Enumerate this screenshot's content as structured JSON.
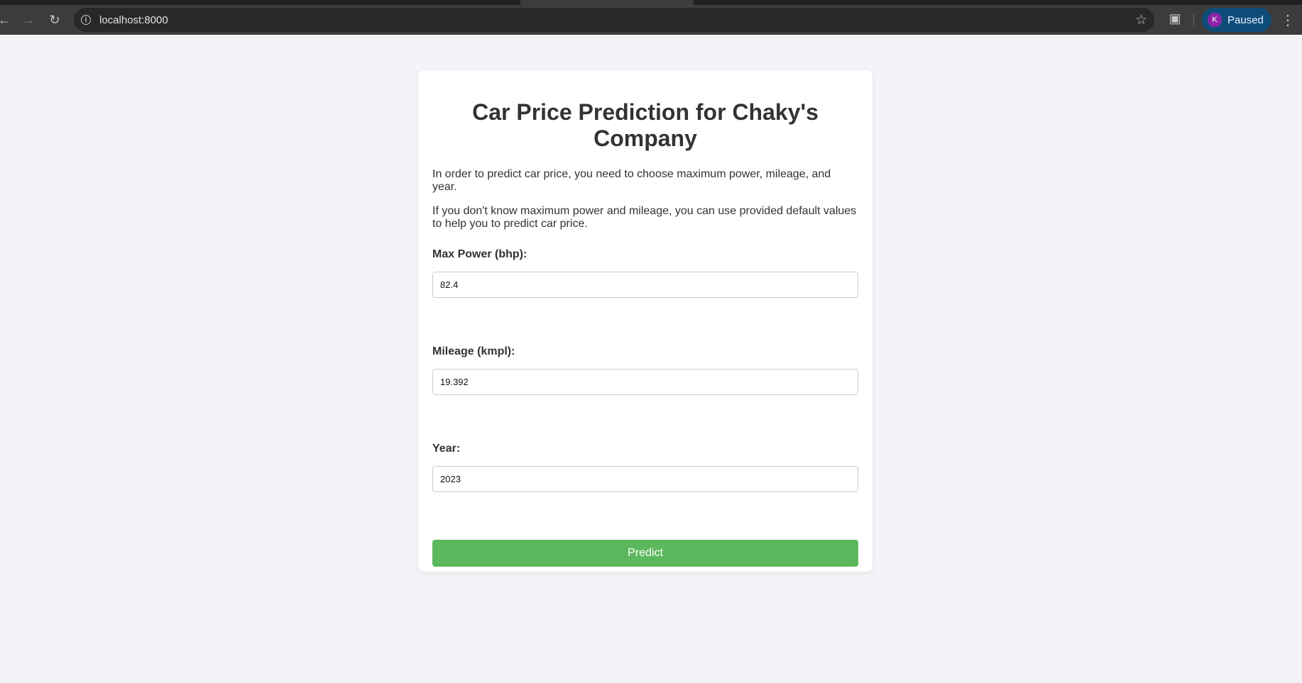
{
  "browser": {
    "url": "localhost:8000",
    "profile_initial": "K",
    "profile_status": "Paused"
  },
  "page": {
    "title": "Car Price Prediction for Chaky's Company",
    "intro_1": "In order to predict car price, you need to choose maximum power, mileage, and year.",
    "intro_2": "If you don't know maximum power and mileage, you can use provided default values to help you to predict car price."
  },
  "form": {
    "max_power": {
      "label": "Max Power (bhp):",
      "value": "82.4"
    },
    "mileage": {
      "label": "Mileage (kmpl):",
      "value": "19.392"
    },
    "year": {
      "label": "Year:",
      "value": "2023"
    },
    "submit_label": "Predict"
  },
  "colors": {
    "accent_button": "#5cb85c",
    "page_background": "#f4f4f8",
    "profile_pill": "#0f4c7a"
  },
  "icons": {
    "back": "back-arrow-icon",
    "forward": "forward-arrow-icon",
    "reload": "reload-icon",
    "site_info": "info-icon",
    "bookmark": "star-icon",
    "extensions": "puzzle-icon",
    "menu": "kebab-menu-icon"
  }
}
